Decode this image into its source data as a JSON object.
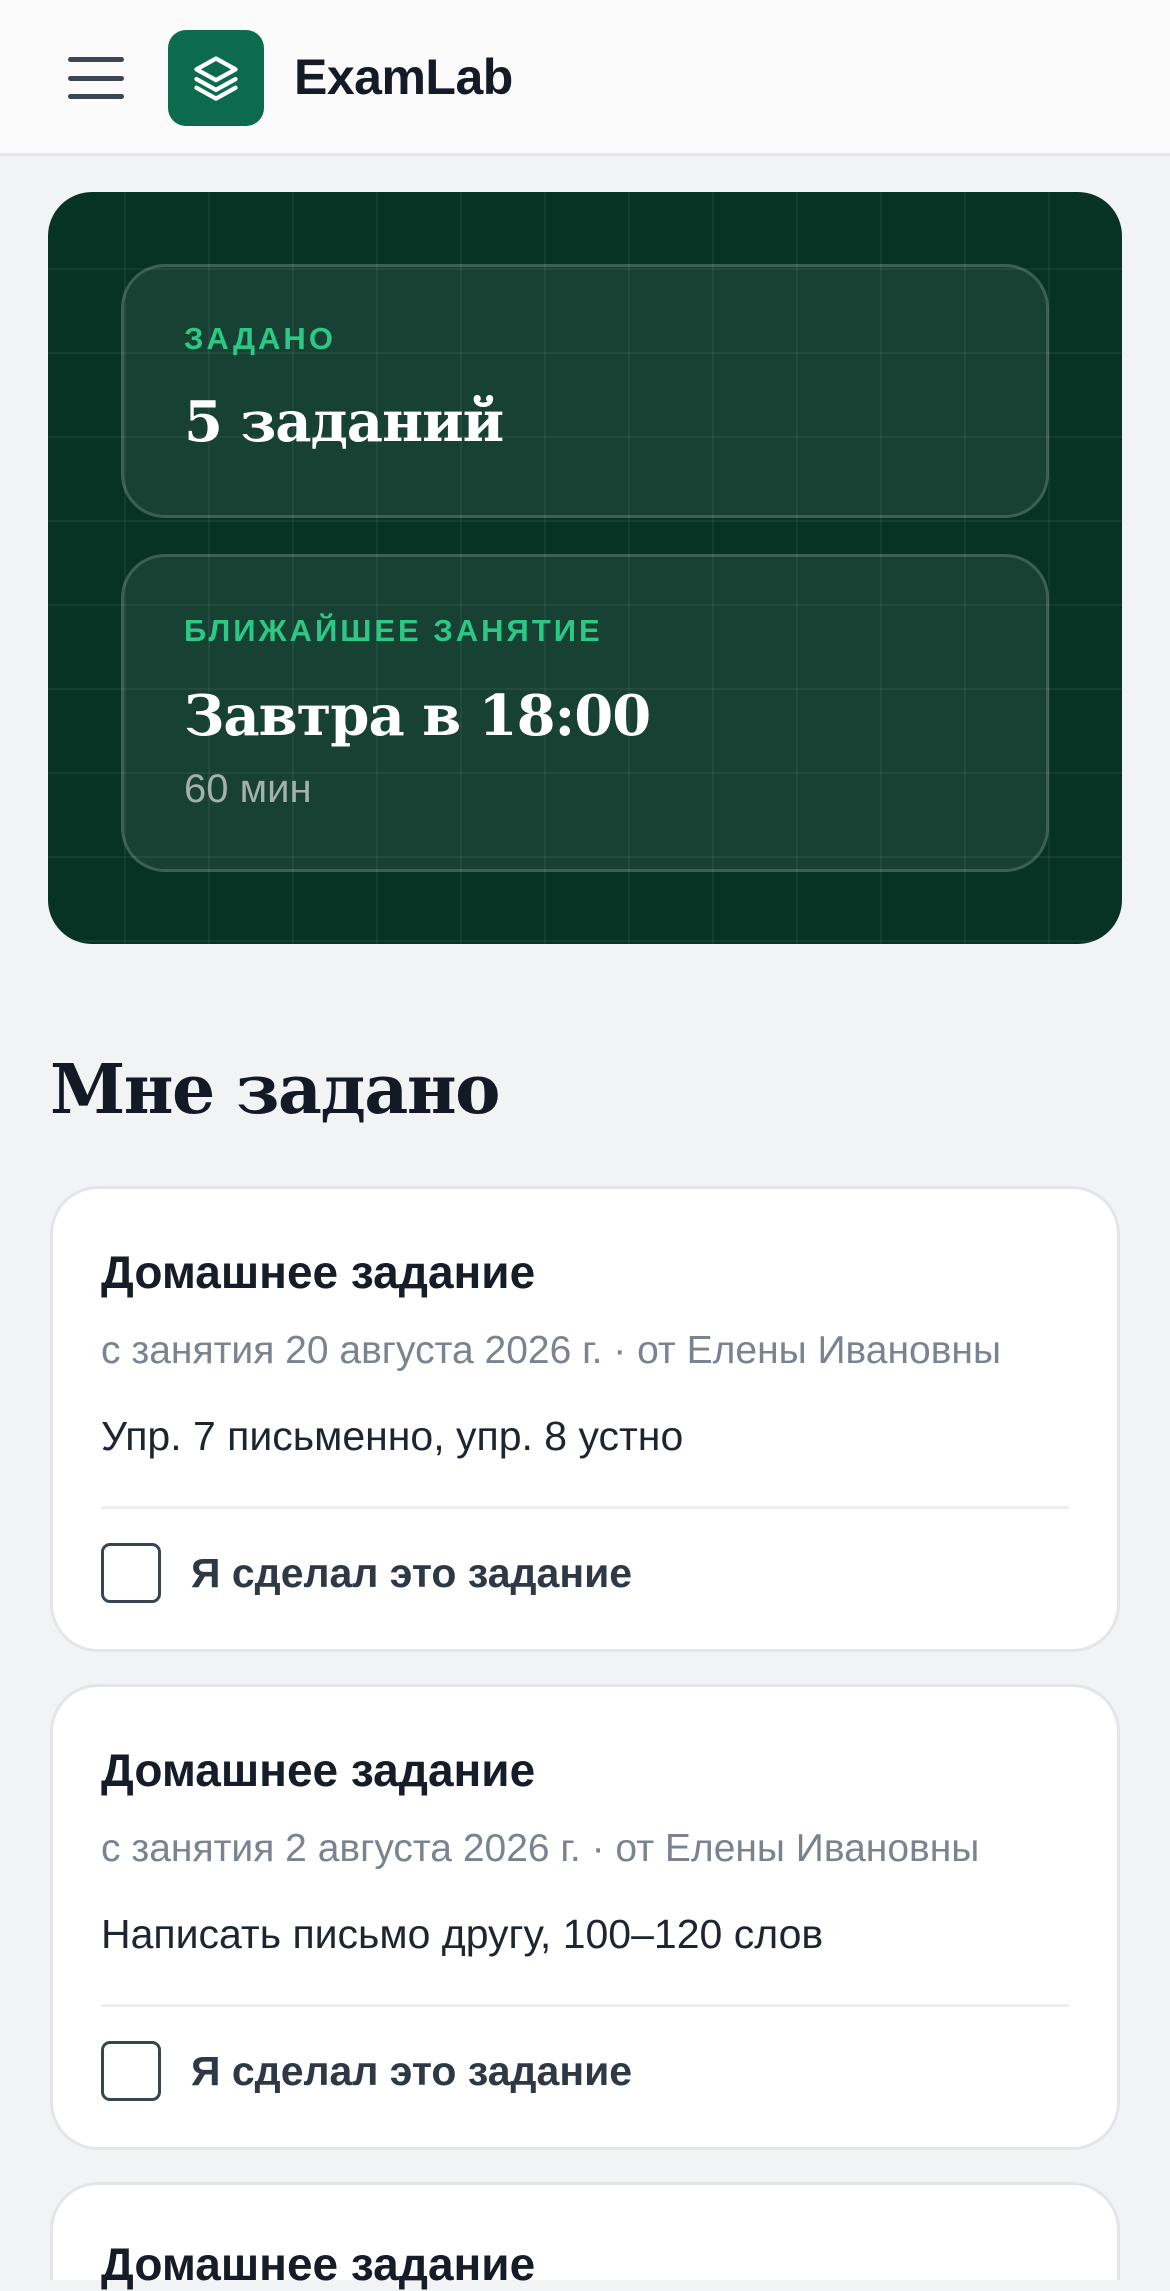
{
  "header": {
    "app_title": "ExamLab",
    "menu_icon": "hamburger-menu-icon",
    "logo_icon": "layers-icon",
    "logo_color": "#0c6b4c"
  },
  "hero": {
    "assigned": {
      "label": "ЗАДАНО",
      "value": "5 заданий"
    },
    "next_lesson": {
      "label": "БЛИЖАЙШЕЕ ЗАНЯТИЕ",
      "value": "Завтра в 18:00",
      "duration": "60 мин"
    },
    "accent_color": "#2cc885",
    "background_color": "#063324"
  },
  "section": {
    "title": "Мне задано"
  },
  "homework": [
    {
      "title": "Домашнее задание",
      "meta": "с занятия 20 августа 2026 г. · от Елены Ивановны",
      "description": "Упр. 7 письменно, упр. 8 устно",
      "checkbox_label": "Я сделал это задание",
      "checked": false
    },
    {
      "title": "Домашнее задание",
      "meta": "с занятия 2 августа 2026 г. · от Елены Ивановны",
      "description": "Написать письмо другу, 100–120 слов",
      "checkbox_label": "Я сделал это задание",
      "checked": false
    },
    {
      "title": "Домашнее задание"
    }
  ]
}
